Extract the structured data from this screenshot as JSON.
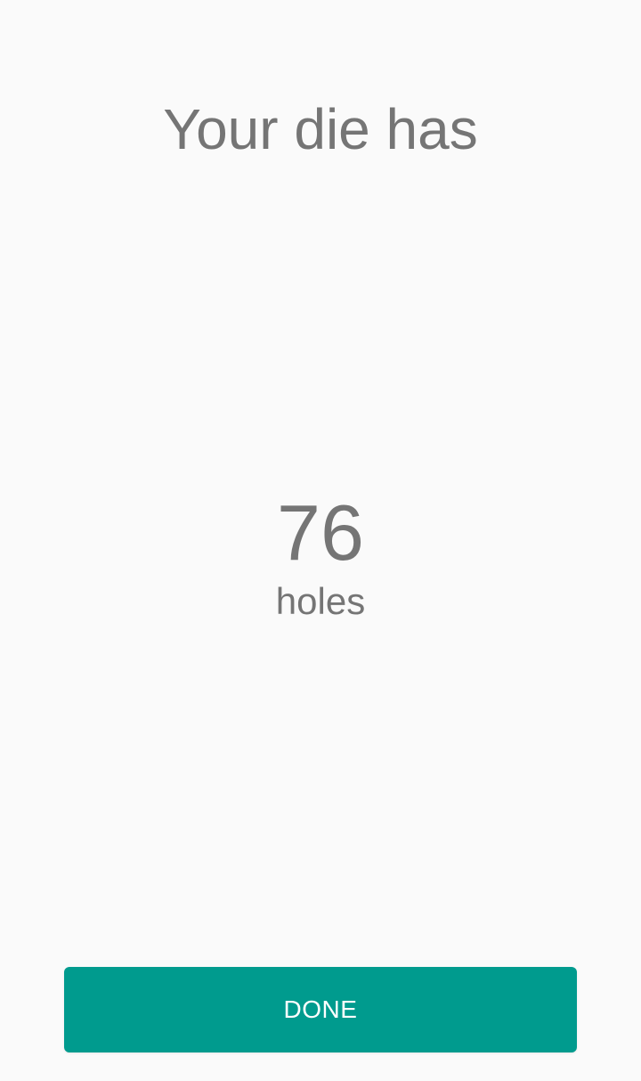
{
  "screen": {
    "heading": "Your die has",
    "result": {
      "value": "76",
      "unit": "holes"
    },
    "done_label": "DONE"
  },
  "colors": {
    "background": "#fafafa",
    "text": "#757575",
    "accent": "#009b8e",
    "button_text": "#ffffff"
  }
}
